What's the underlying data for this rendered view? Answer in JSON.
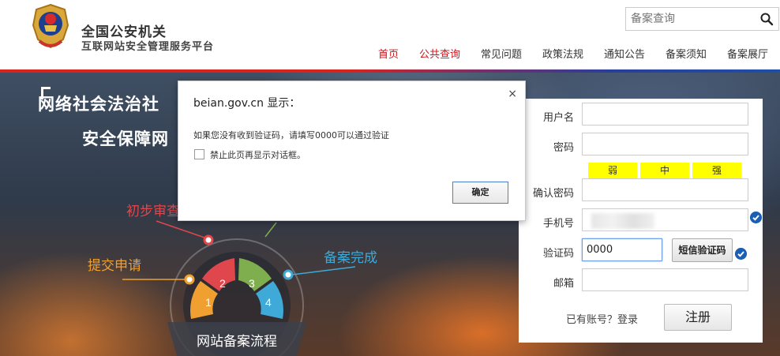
{
  "header": {
    "title": "全国公安机关",
    "subtitle": "互联网站安全管理服务平台",
    "search_placeholder": "备案查询"
  },
  "nav": {
    "items": [
      {
        "label": "首页"
      },
      {
        "label": "公共查询"
      },
      {
        "label": "常见问题"
      },
      {
        "label": "政策法规"
      },
      {
        "label": "通知公告"
      },
      {
        "label": "备案须知"
      },
      {
        "label": "备案展厅"
      }
    ]
  },
  "banner": {
    "slogan_line1": "网络社会法治社",
    "slogan_line2": "安全保障网",
    "steps": {
      "submit": "提交申请",
      "review": "初步审查",
      "complete": "备案完成",
      "center": "网站备案流程",
      "seg1": "1",
      "seg2": "2",
      "seg3": "3",
      "seg4": "4"
    }
  },
  "dialog": {
    "title": "beian.gov.cn 显示：",
    "message": "如果您没有收到验证码，请填写0000可以通过验证",
    "checkbox_label": "禁止此页再显示对话框。",
    "ok_label": "确定",
    "close": "×"
  },
  "form": {
    "username_label": "用户名",
    "password_label": "密码",
    "strength": [
      "弱",
      "中",
      "强"
    ],
    "confirm_label": "确认密码",
    "phone_label": "手机号",
    "code_label": "验证码",
    "code_value": "0000",
    "sms_button": "短信验证码",
    "email_label": "邮箱",
    "login_link": "已有账号？登录",
    "register_button": "注册"
  },
  "colors": {
    "accent_red": "#c8161d",
    "seg1": "#f0a030",
    "seg2": "#e0474c",
    "seg3": "#7fae4f",
    "seg4": "#3fa9d8",
    "strength_yellow": "#ffff00",
    "check_blue": "#1a5fb4"
  }
}
